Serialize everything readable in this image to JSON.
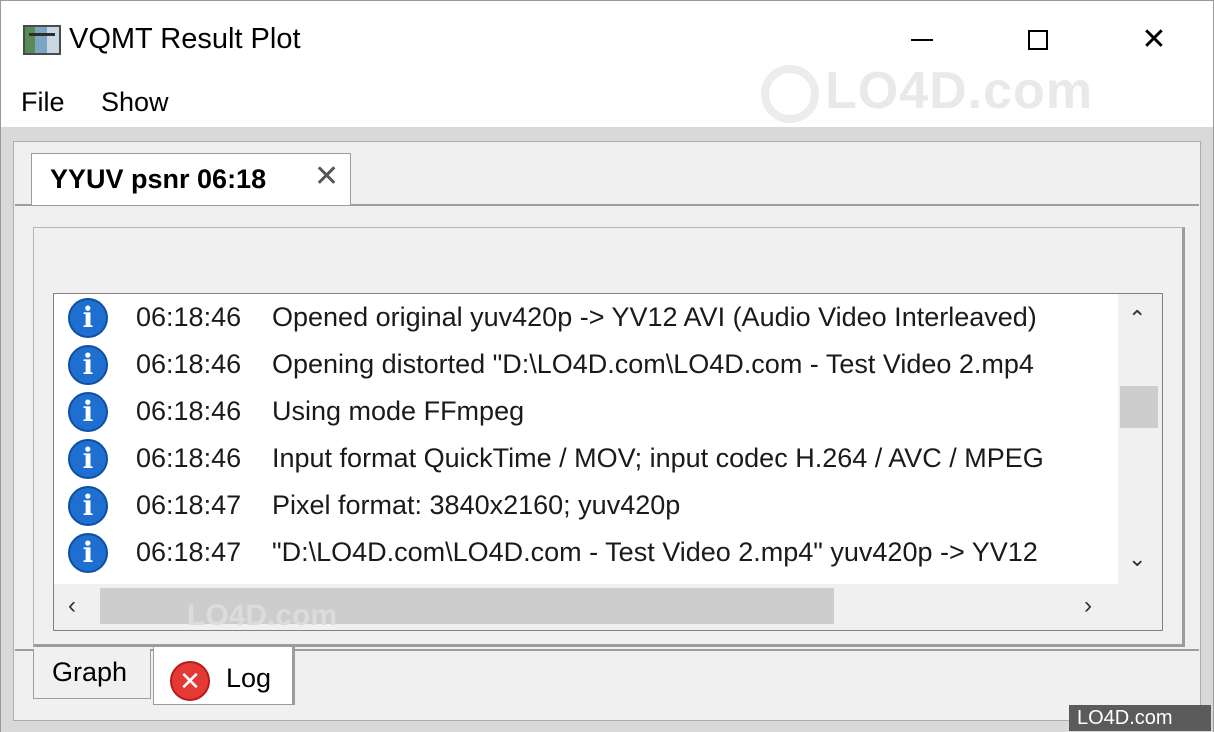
{
  "window": {
    "title": "VQMT Result Plot"
  },
  "menu": {
    "file": "File",
    "show": "Show"
  },
  "tabs": {
    "top": "YYUV psnr 06:18",
    "graph": "Graph",
    "log": "Log"
  },
  "log": {
    "rows": [
      {
        "time": "06:18:46",
        "message": "Opened original yuv420p -> YV12 AVI (Audio Video Interleaved)"
      },
      {
        "time": "06:18:46",
        "message": "Opening distorted \"D:\\LO4D.com\\LO4D.com - Test Video 2.mp4"
      },
      {
        "time": "06:18:46",
        "message": "Using mode FFmpeg"
      },
      {
        "time": "06:18:46",
        "message": "Input format QuickTime / MOV; input codec H.264 / AVC / MPEG"
      },
      {
        "time": "06:18:47",
        "message": "Pixel format: 3840x2160; yuv420p"
      },
      {
        "time": "06:18:47",
        "message": "\"D:\\LO4D.com\\LO4D.com - Test Video 2.mp4\" yuv420p -> YV12"
      }
    ]
  },
  "watermark": {
    "text": "LO4D.com"
  },
  "colors": {
    "info": "#1e6fd0",
    "error": "#e53935",
    "frame": "#d9d9d9"
  },
  "icons": {
    "info": "i",
    "error": "✕",
    "up": "⌃",
    "down": "⌄",
    "left": "‹",
    "right": "›"
  }
}
